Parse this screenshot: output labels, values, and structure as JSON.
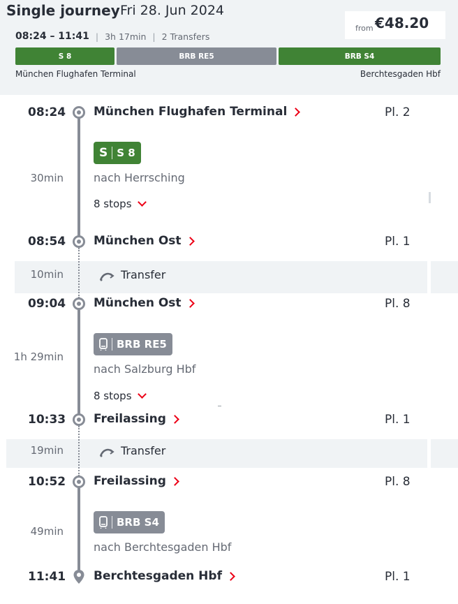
{
  "header": {
    "title": "Single journey",
    "date": "Fri 28. Jun 2024",
    "price_from": "from",
    "price": "€48.20",
    "times": "08:24 – 11:41",
    "duration": "3h 17min",
    "transfers": "2 Transfers",
    "separator": "|",
    "segments": [
      "S 8",
      "BRB RE5",
      "BRB S4"
    ],
    "from_station": "München Flughafen Terminal",
    "to_station": "Berchtesgaden Hbf"
  },
  "colors": {
    "green": "#408335",
    "grey": "#878c96",
    "red": "#ec0016",
    "panel": "#f0f3f5"
  },
  "stops": [
    {
      "time": "08:24",
      "station": "München Flughafen Terminal",
      "platform": "Pl. 2"
    },
    {
      "time": "08:54",
      "station": "München Ost",
      "platform": "Pl. 1"
    },
    {
      "time": "09:04",
      "station": "München Ost",
      "platform": "Pl. 8"
    },
    {
      "time": "10:33",
      "station": "Freilassing",
      "platform": "Pl. 1"
    },
    {
      "time": "10:52",
      "station": "Freilassing",
      "platform": "Pl. 8"
    },
    {
      "time": "11:41",
      "station": "Berchtesgaden Hbf",
      "platform": "Pl. 1"
    }
  ],
  "legs": [
    {
      "duration": "30min",
      "badge_prefix": "S",
      "line": "S 8",
      "direction": "nach Herrsching",
      "stops": "8 stops",
      "icon": "s-bahn-icon"
    },
    {
      "duration": "1h 29min",
      "line": "BRB RE5",
      "direction": "nach Salzburg Hbf",
      "stops": "8 stops",
      "icon": "train-icon"
    },
    {
      "duration": "49min",
      "line": "BRB S4",
      "direction": "nach Berchtesgaden Hbf",
      "icon": "train-icon"
    }
  ],
  "transfers": [
    {
      "duration": "10min",
      "label": "Transfer",
      "icon": "walk-icon"
    },
    {
      "duration": "19min",
      "label": "Transfer",
      "icon": "walk-icon"
    }
  ]
}
